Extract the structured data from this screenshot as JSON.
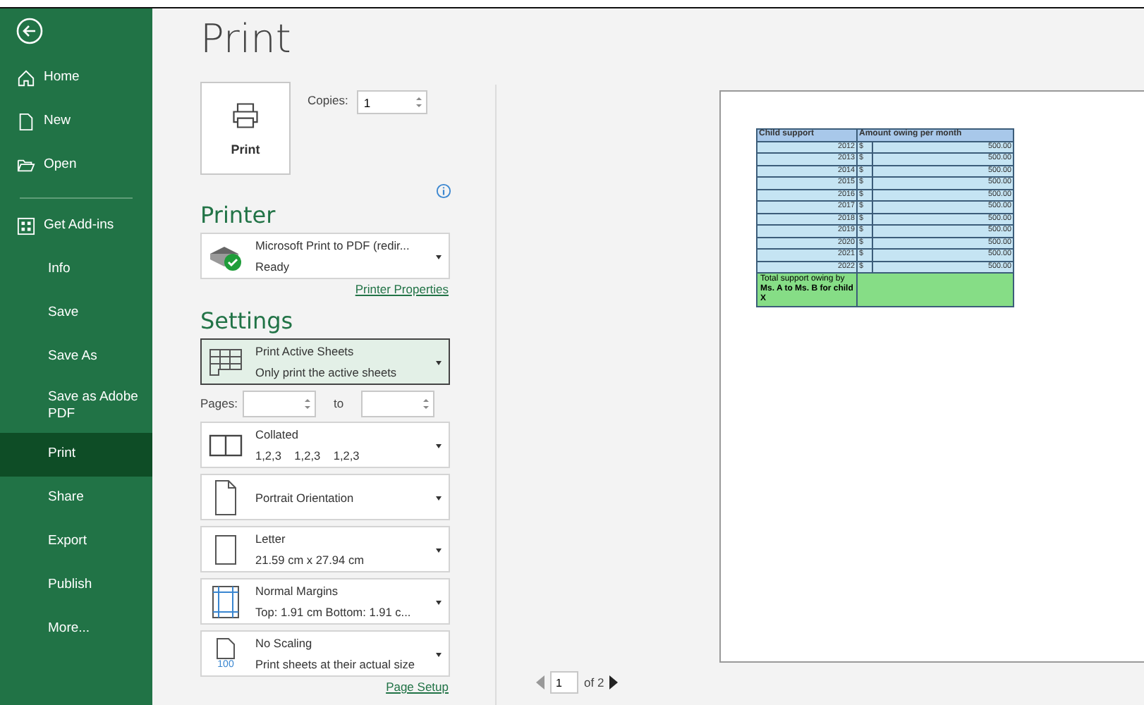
{
  "sidebar": {
    "items": [
      {
        "label": "Home",
        "kind": "home",
        "selected": false
      },
      {
        "label": "New",
        "kind": "new",
        "selected": false
      },
      {
        "label": "Open",
        "kind": "open",
        "selected": false
      },
      {
        "label": "Get Add-ins",
        "kind": "addins",
        "selected": false
      },
      {
        "label": "Info",
        "selected": false
      },
      {
        "label": "Save",
        "selected": false
      },
      {
        "label": "Save As",
        "selected": false
      },
      {
        "label": "Save as Adobe PDF",
        "selected": false
      },
      {
        "label": "Print",
        "selected": true
      },
      {
        "label": "Share",
        "selected": false
      },
      {
        "label": "Export",
        "selected": false
      },
      {
        "label": "Publish",
        "selected": false
      },
      {
        "label": "More...",
        "selected": false
      }
    ]
  },
  "title": "Print",
  "print_button": {
    "label": "Print"
  },
  "copies": {
    "label": "Copies:",
    "value": "1"
  },
  "printer": {
    "heading": "Printer",
    "name": "Microsoft Print to PDF (redir...",
    "status": "Ready",
    "properties_link": "Printer Properties"
  },
  "settings": {
    "heading": "Settings",
    "dropdowns_top": [
      {
        "kind": "sheets",
        "line1": "Print Active Sheets",
        "line2": "Only print the active sheets",
        "selected": true
      }
    ],
    "pages": {
      "label": "Pages:",
      "to": "to"
    },
    "dropdowns": [
      {
        "kind": "collated",
        "line1": "Collated",
        "line2": "1,2,3    1,2,3    1,2,3",
        "selected": false
      },
      {
        "kind": "portrait",
        "line1": "Portrait Orientation",
        "selected": false
      },
      {
        "kind": "letter",
        "line1": "Letter",
        "line2": "21.59 cm x 27.94 cm",
        "selected": false
      },
      {
        "kind": "margins",
        "line1": "Normal Margins",
        "line2": "Top: 1.91 cm Bottom: 1.91 c...",
        "selected": false
      },
      {
        "kind": "scaling",
        "line1": "No Scaling",
        "line2": "Print sheets at their actual size",
        "icon_text": "100",
        "selected": false
      }
    ],
    "page_setup_link": "Page Setup"
  },
  "preview": {
    "table": {
      "columns": [
        "Child support",
        "Amount owing per month"
      ],
      "rows": [
        {
          "year": "2012",
          "currency": "$",
          "amount": "500.00"
        },
        {
          "year": "2013",
          "currency": "$",
          "amount": "500.00"
        },
        {
          "year": "2014",
          "currency": "$",
          "amount": "500.00"
        },
        {
          "year": "2015",
          "currency": "$",
          "amount": "500.00"
        },
        {
          "year": "2016",
          "currency": "$",
          "amount": "500.00"
        },
        {
          "year": "2017",
          "currency": "$",
          "amount": "500.00"
        },
        {
          "year": "2018",
          "currency": "$",
          "amount": "500.00"
        },
        {
          "year": "2019",
          "currency": "$",
          "amount": "500.00"
        },
        {
          "year": "2020",
          "currency": "$",
          "amount": "500.00"
        },
        {
          "year": "2021",
          "currency": "$",
          "amount": "500.00"
        },
        {
          "year": "2022",
          "currency": "$",
          "amount": "500.00"
        }
      ],
      "total_label": "Total support owing by **Ms. A to Ms. B for child X**"
    },
    "page": {
      "value": "1",
      "of": "of 2"
    }
  }
}
